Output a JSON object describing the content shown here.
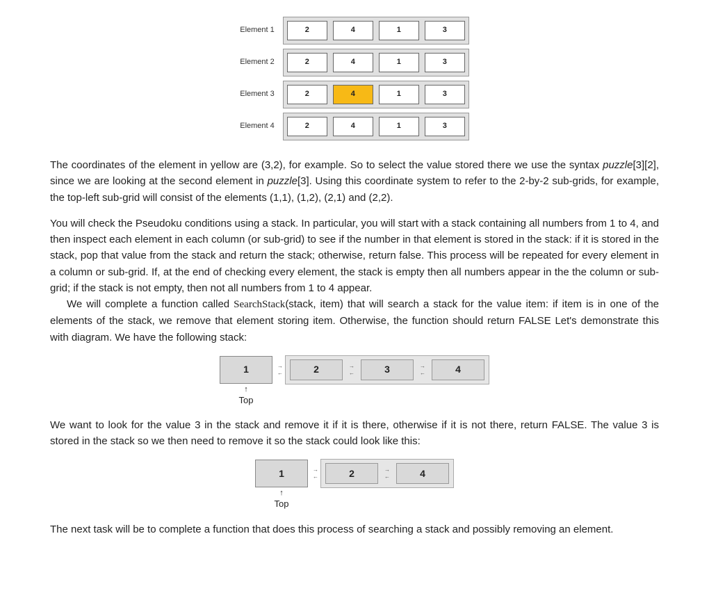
{
  "grid": {
    "rows": [
      {
        "label": "Element 1",
        "cells": [
          "2",
          "4",
          "1",
          "3"
        ],
        "hl": -1
      },
      {
        "label": "Element 2",
        "cells": [
          "2",
          "4",
          "1",
          "3"
        ],
        "hl": -1
      },
      {
        "label": "Element 3",
        "cells": [
          "2",
          "4",
          "1",
          "3"
        ],
        "hl": 1
      },
      {
        "label": "Element 4",
        "cells": [
          "2",
          "4",
          "1",
          "3"
        ],
        "hl": -1
      }
    ]
  },
  "p1": {
    "t0": "The coordinates of the element in yellow are (3,2), for example. So to select the value stored there we use the syntax ",
    "i1": "puzzle",
    "t1": "[3][2], since we are looking at the second element in ",
    "i2": "puzzle",
    "t2": "[3]. Using this coordinate system to refer to the 2-by-2 sub-grids, for example, the top-left sub-grid will consist of the elements (1,1), (1,2), (2,1) and (2,2)."
  },
  "p2": "You will check the Pseudoku conditions using a stack. In particular, you will start with a stack containing all numbers from 1 to 4, and then inspect each element in each column (or sub-grid) to see if the number in that element is stored in the stack: if it is stored in the stack, pop that value from the stack and return the stack; otherwise, return false. This process will be repeated for every element in a column or sub-grid. If, at the end of checking every element, the stack is empty then all numbers appear in the the column or sub-grid; if the stack is not empty, then not all numbers from 1 to 4 appear.",
  "p3": {
    "t0": "We will complete a function called ",
    "fn": "SearchStack",
    "t1": "(stack, item) that will search a stack for the value item: if item is in one of the elements of the stack, we remove that element storing item. Otherwise, the function should return FALSE Let's demonstrate this with diagram. We have the following stack:"
  },
  "stack1": {
    "lead": "1",
    "rest": [
      "2",
      "3",
      "4"
    ],
    "top": "Top"
  },
  "p4": "We want to look for the value 3 in the stack and remove it if it is there, otherwise if it is not there, return FALSE. The value 3 is stored in the stack so we then need to remove it so the stack could look like this:",
  "stack2": {
    "lead": "1",
    "rest": [
      "2",
      "4"
    ],
    "top": "Top"
  },
  "p5": "The next task will be to complete a function that does this process of searching a stack and possibly removing an element."
}
